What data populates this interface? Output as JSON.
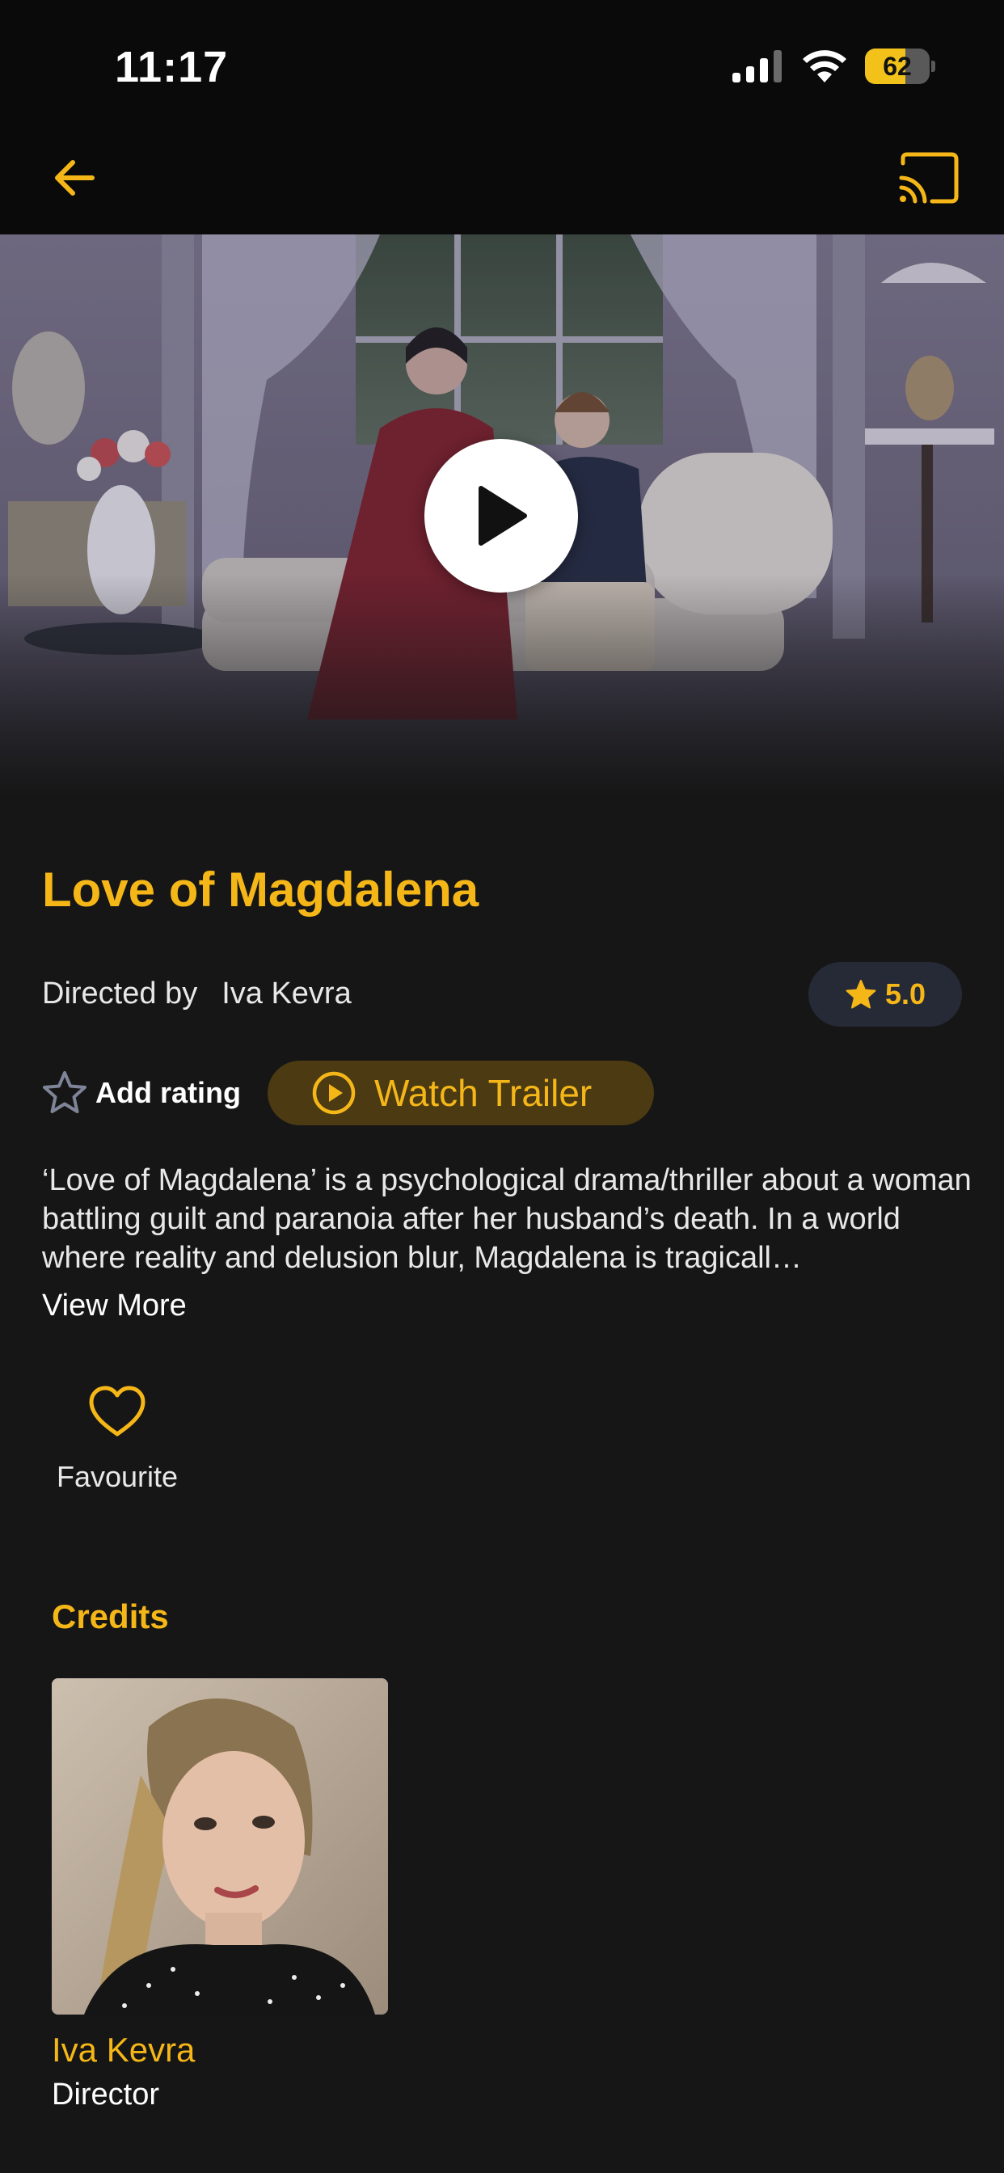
{
  "status_bar": {
    "time": "11:17",
    "battery_percent": 62
  },
  "nav": {
    "back_icon": "arrow-left-icon",
    "cast_icon": "cast-icon"
  },
  "hero": {
    "play_icon": "play-icon"
  },
  "movie": {
    "title": "Love of Magdalena",
    "directed_by_label": "Directed by",
    "director": "Iva Kevra",
    "rating": "5.0",
    "description": "‘Love of Magdalena’ is a psychological drama/thriller about a woman battling guilt and paranoia after her husband’s death. In a world where reality and delusion blur, Magdalena is tragicall…",
    "view_more_label": "View More"
  },
  "actions": {
    "add_rating_label": "Add rating",
    "watch_trailer_label": "Watch Trailer",
    "favourite_label": "Favourite"
  },
  "credits": {
    "heading": "Credits",
    "items": [
      {
        "name": "Iva Kevra",
        "role": "Director"
      }
    ]
  },
  "colors": {
    "accent": "#f5b718",
    "background": "#161616",
    "topbar": "#0a0a0a",
    "rating_pill": "#252a36",
    "trailer_button": "#4b3a12"
  }
}
